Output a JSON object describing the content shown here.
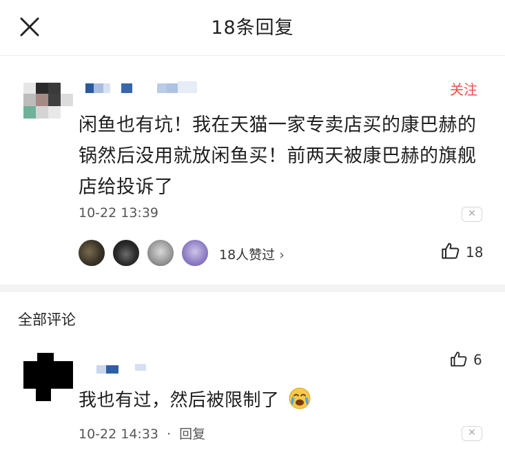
{
  "header": {
    "title": "18条回复"
  },
  "post": {
    "follow_label": "关注",
    "text": "闲鱼也有坑！我在天猫一家专卖店买的康巴赫的锅然后没用就放闲鱼买！前两天被康巴赫的旗舰店给投诉了",
    "time": "10-22 13:39",
    "likes_text": "18人赞过",
    "like_count": "18"
  },
  "comments_section": {
    "title": "全部评论"
  },
  "comment": {
    "text": "我也有过，然后被限制了",
    "time": "10-22 14:33",
    "separator": "·",
    "reply_label": "回复",
    "like_count": "6"
  },
  "colors": {
    "accent": "#e8514a",
    "text": "#1e1e1e",
    "muted": "#555555"
  }
}
